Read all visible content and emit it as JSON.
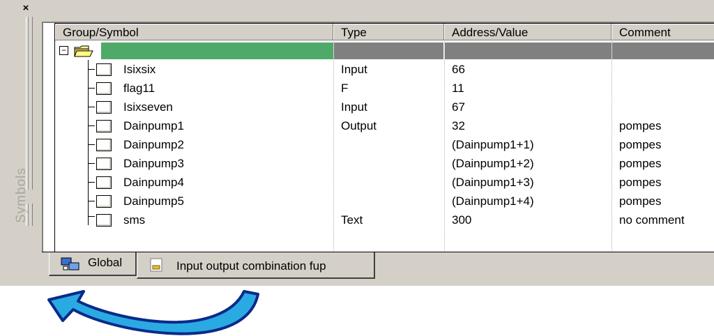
{
  "window": {
    "close_glyph": "×",
    "side_label": "Symbols"
  },
  "table": {
    "headers": {
      "group": "Group/Symbol",
      "type": "Type",
      "address": "Address/Value",
      "comment": "Comment"
    },
    "root": {
      "expander": "−",
      "selected_color": "#4fa968"
    },
    "rows": [
      {
        "name": "Isixsix",
        "type": "Input",
        "address": "66",
        "comment": ""
      },
      {
        "name": "flag11",
        "type": "F",
        "address": "11",
        "comment": ""
      },
      {
        "name": "Isixseven",
        "type": "Input",
        "address": "67",
        "comment": ""
      },
      {
        "name": "Dainpump1",
        "type": "Output",
        "address": "32",
        "comment": "pompes"
      },
      {
        "name": "Dainpump2",
        "type": "",
        "address": "(Dainpump1+1)",
        "comment": "pompes"
      },
      {
        "name": "Dainpump3",
        "type": "",
        "address": "(Dainpump1+2)",
        "comment": "pompes"
      },
      {
        "name": "Dainpump4",
        "type": "",
        "address": "(Dainpump1+3)",
        "comment": "pompes"
      },
      {
        "name": "Dainpump5",
        "type": "",
        "address": "(Dainpump1+4)",
        "comment": "pompes"
      },
      {
        "name": "sms",
        "type": "Text",
        "address": "300",
        "comment": "no comment"
      }
    ]
  },
  "tabs": [
    {
      "label": "Global",
      "icon": "global-symbols-icon",
      "active": false
    },
    {
      "label": "Input output combination fup",
      "icon": "fup-document-icon",
      "active": true
    }
  ],
  "annotation": {
    "icon": "curved-arrow-icon",
    "colors": {
      "fill": "#2aaae2",
      "outline": "#0a2a8a"
    }
  }
}
